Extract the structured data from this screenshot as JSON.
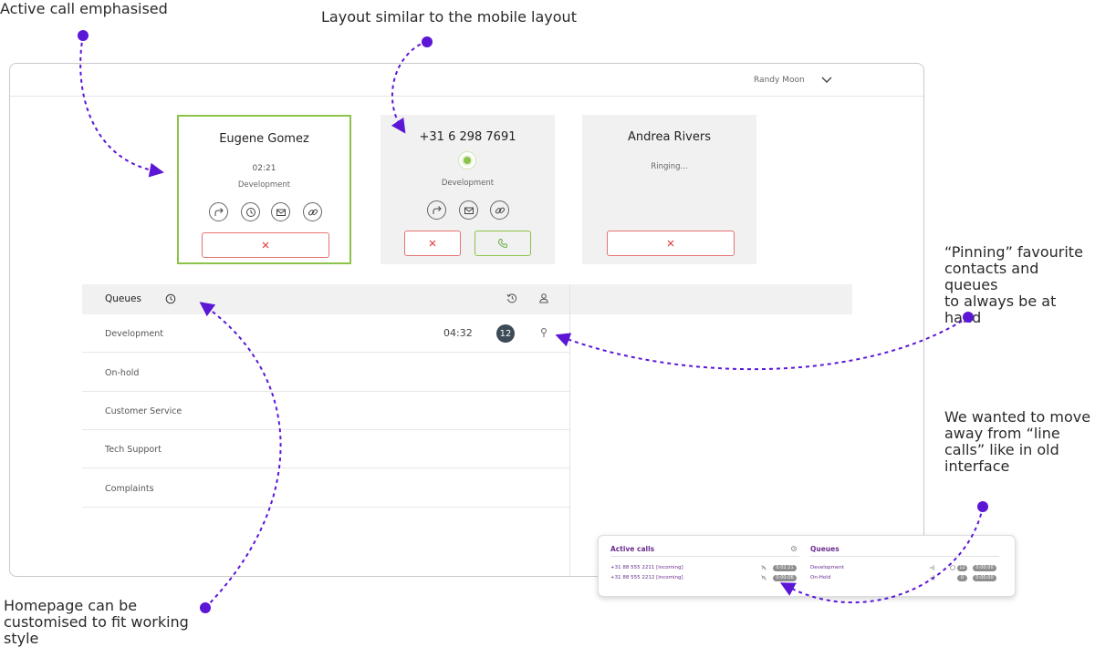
{
  "annotations": {
    "active_call": "Active call emphasised",
    "mobile_layout": "Layout similar to the mobile layout",
    "pinning": [
      "“Pinning” favourite",
      "contacts and queues",
      "to always be at hand"
    ],
    "line_calls": [
      "We wanted to move",
      "away from “line",
      "calls” like in old",
      "interface"
    ],
    "homepage": [
      "Homepage can be",
      "customised to fit working",
      "style"
    ]
  },
  "colors": {
    "accent": "#5b16d6",
    "active_border": "#8bc34a",
    "decline": "#e53935",
    "badge": "#3d4a57",
    "mini_title": "#6a2d8f"
  },
  "header": {
    "user_name": "Randy Moon"
  },
  "calls": [
    {
      "name": "Eugene Gomez",
      "time": "02:21",
      "department": "Development"
    },
    {
      "name": "+31 6 298 7691",
      "department": "Development"
    },
    {
      "name": "Andrea Rivers",
      "status": "Ringing..."
    }
  ],
  "queues": {
    "title": "Queues",
    "rows": [
      {
        "name": "Development",
        "wait": "04:32",
        "count": "12"
      },
      {
        "name": "On-hold"
      },
      {
        "name": "Customer Service"
      },
      {
        "name": "Tech Support"
      },
      {
        "name": "Complaints"
      }
    ]
  },
  "old_widget": {
    "active_calls_title": "Active calls",
    "queues_title": "Queues",
    "calls": [
      {
        "number": "+31 88 555 2211 [incoming]",
        "duration": "0:02:21"
      },
      {
        "number": "+31 88 555 2212 [incoming]",
        "duration": "0:00:06"
      }
    ],
    "queues": [
      {
        "name": "Development",
        "count": "12",
        "duration": "0:00:00"
      },
      {
        "name": "On-Hold",
        "count": "0",
        "duration": "0:00:00"
      }
    ]
  }
}
